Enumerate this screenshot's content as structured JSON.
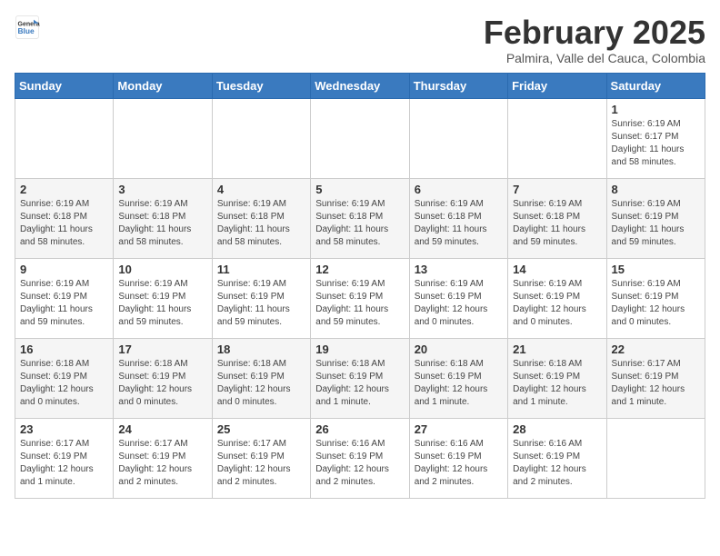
{
  "header": {
    "logo_general": "General",
    "logo_blue": "Blue",
    "title": "February 2025",
    "subtitle": "Palmira, Valle del Cauca, Colombia"
  },
  "weekdays": [
    "Sunday",
    "Monday",
    "Tuesday",
    "Wednesday",
    "Thursday",
    "Friday",
    "Saturday"
  ],
  "weeks": [
    [
      {
        "day": "",
        "info": ""
      },
      {
        "day": "",
        "info": ""
      },
      {
        "day": "",
        "info": ""
      },
      {
        "day": "",
        "info": ""
      },
      {
        "day": "",
        "info": ""
      },
      {
        "day": "",
        "info": ""
      },
      {
        "day": "1",
        "info": "Sunrise: 6:19 AM\nSunset: 6:17 PM\nDaylight: 11 hours\nand 58 minutes."
      }
    ],
    [
      {
        "day": "2",
        "info": "Sunrise: 6:19 AM\nSunset: 6:18 PM\nDaylight: 11 hours\nand 58 minutes."
      },
      {
        "day": "3",
        "info": "Sunrise: 6:19 AM\nSunset: 6:18 PM\nDaylight: 11 hours\nand 58 minutes."
      },
      {
        "day": "4",
        "info": "Sunrise: 6:19 AM\nSunset: 6:18 PM\nDaylight: 11 hours\nand 58 minutes."
      },
      {
        "day": "5",
        "info": "Sunrise: 6:19 AM\nSunset: 6:18 PM\nDaylight: 11 hours\nand 58 minutes."
      },
      {
        "day": "6",
        "info": "Sunrise: 6:19 AM\nSunset: 6:18 PM\nDaylight: 11 hours\nand 59 minutes."
      },
      {
        "day": "7",
        "info": "Sunrise: 6:19 AM\nSunset: 6:18 PM\nDaylight: 11 hours\nand 59 minutes."
      },
      {
        "day": "8",
        "info": "Sunrise: 6:19 AM\nSunset: 6:19 PM\nDaylight: 11 hours\nand 59 minutes."
      }
    ],
    [
      {
        "day": "9",
        "info": "Sunrise: 6:19 AM\nSunset: 6:19 PM\nDaylight: 11 hours\nand 59 minutes."
      },
      {
        "day": "10",
        "info": "Sunrise: 6:19 AM\nSunset: 6:19 PM\nDaylight: 11 hours\nand 59 minutes."
      },
      {
        "day": "11",
        "info": "Sunrise: 6:19 AM\nSunset: 6:19 PM\nDaylight: 11 hours\nand 59 minutes."
      },
      {
        "day": "12",
        "info": "Sunrise: 6:19 AM\nSunset: 6:19 PM\nDaylight: 11 hours\nand 59 minutes."
      },
      {
        "day": "13",
        "info": "Sunrise: 6:19 AM\nSunset: 6:19 PM\nDaylight: 12 hours\nand 0 minutes."
      },
      {
        "day": "14",
        "info": "Sunrise: 6:19 AM\nSunset: 6:19 PM\nDaylight: 12 hours\nand 0 minutes."
      },
      {
        "day": "15",
        "info": "Sunrise: 6:19 AM\nSunset: 6:19 PM\nDaylight: 12 hours\nand 0 minutes."
      }
    ],
    [
      {
        "day": "16",
        "info": "Sunrise: 6:18 AM\nSunset: 6:19 PM\nDaylight: 12 hours\nand 0 minutes."
      },
      {
        "day": "17",
        "info": "Sunrise: 6:18 AM\nSunset: 6:19 PM\nDaylight: 12 hours\nand 0 minutes."
      },
      {
        "day": "18",
        "info": "Sunrise: 6:18 AM\nSunset: 6:19 PM\nDaylight: 12 hours\nand 0 minutes."
      },
      {
        "day": "19",
        "info": "Sunrise: 6:18 AM\nSunset: 6:19 PM\nDaylight: 12 hours\nand 1 minute."
      },
      {
        "day": "20",
        "info": "Sunrise: 6:18 AM\nSunset: 6:19 PM\nDaylight: 12 hours\nand 1 minute."
      },
      {
        "day": "21",
        "info": "Sunrise: 6:18 AM\nSunset: 6:19 PM\nDaylight: 12 hours\nand 1 minute."
      },
      {
        "day": "22",
        "info": "Sunrise: 6:17 AM\nSunset: 6:19 PM\nDaylight: 12 hours\nand 1 minute."
      }
    ],
    [
      {
        "day": "23",
        "info": "Sunrise: 6:17 AM\nSunset: 6:19 PM\nDaylight: 12 hours\nand 1 minute."
      },
      {
        "day": "24",
        "info": "Sunrise: 6:17 AM\nSunset: 6:19 PM\nDaylight: 12 hours\nand 2 minutes."
      },
      {
        "day": "25",
        "info": "Sunrise: 6:17 AM\nSunset: 6:19 PM\nDaylight: 12 hours\nand 2 minutes."
      },
      {
        "day": "26",
        "info": "Sunrise: 6:16 AM\nSunset: 6:19 PM\nDaylight: 12 hours\nand 2 minutes."
      },
      {
        "day": "27",
        "info": "Sunrise: 6:16 AM\nSunset: 6:19 PM\nDaylight: 12 hours\nand 2 minutes."
      },
      {
        "day": "28",
        "info": "Sunrise: 6:16 AM\nSunset: 6:19 PM\nDaylight: 12 hours\nand 2 minutes."
      },
      {
        "day": "",
        "info": ""
      }
    ]
  ]
}
